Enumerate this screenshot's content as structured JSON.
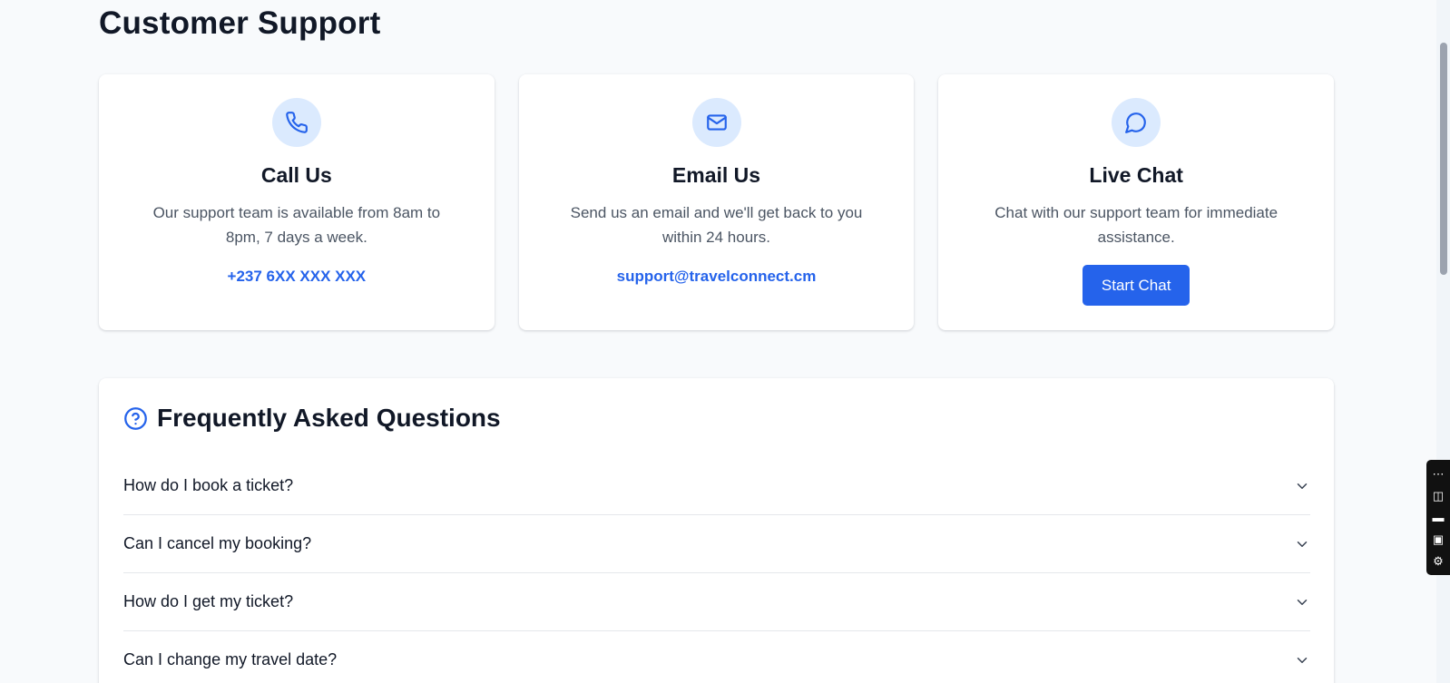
{
  "page": {
    "title": "Customer Support"
  },
  "cards": [
    {
      "icon": "phone-icon",
      "title": "Call Us",
      "description": "Our support team is available from 8am to 8pm, 7 days a week.",
      "link_text": "+237 6XX XXX XXX"
    },
    {
      "icon": "mail-icon",
      "title": "Email Us",
      "description": "Send us an email and we'll get back to you within 24 hours.",
      "link_text": "support@travelconnect.cm"
    },
    {
      "icon": "chat-bubble-icon",
      "title": "Live Chat",
      "description": "Chat with our support team for immediate assistance.",
      "button_label": "Start Chat"
    }
  ],
  "faq": {
    "icon": "question-circle-icon",
    "title": "Frequently Asked Questions",
    "items": [
      {
        "question": "How do I book a ticket?",
        "icon": "chevron-down-icon"
      },
      {
        "question": "Can I cancel my booking?",
        "icon": "chevron-down-icon"
      },
      {
        "question": "How do I get my ticket?",
        "icon": "chevron-down-icon"
      },
      {
        "question": "Can I change my travel date?",
        "icon": "chevron-down-icon"
      }
    ]
  },
  "colors": {
    "accent": "#2563eb",
    "icon_background": "#dbeafe",
    "page_background": "#f8fafc",
    "card_background": "#ffffff"
  },
  "side_toolbar": {
    "icons": [
      "link-more-icon",
      "camera-icon",
      "video-icon",
      "window-icon",
      "gear-icon"
    ]
  }
}
